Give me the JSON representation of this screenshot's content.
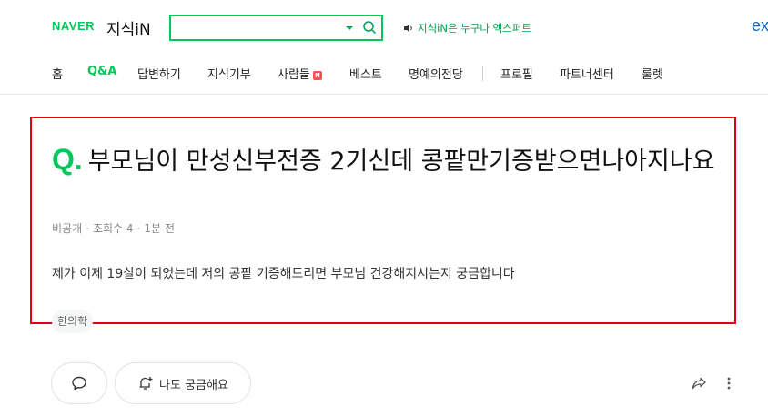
{
  "header": {
    "naver_logo": "NAVER",
    "kin_logo": "지식iN",
    "search_placeholder": "",
    "promo_text": "지식iN은 누구나 엑스퍼트",
    "ex_link": "ex",
    "accent": "#03c75a"
  },
  "nav": {
    "items": [
      {
        "label": "홈"
      },
      {
        "label": "Q&A"
      },
      {
        "label": "답변하기"
      },
      {
        "label": "지식기부"
      },
      {
        "label": "사람들"
      },
      {
        "label": "베스트"
      },
      {
        "label": "명예의전당"
      },
      {
        "label": "프로필"
      },
      {
        "label": "파트너센터"
      },
      {
        "label": "룰렛"
      }
    ],
    "badge": "N"
  },
  "question": {
    "q_mark": "Q.",
    "title": "부모님이 만성신부전증 2기신데 콩팥만기증받으면나아지나요",
    "author": "비공개",
    "views": "조회수 4",
    "time": "1분 전",
    "body": "제가 이제 19살이 되었는데 저의 콩팥 기증해드리면 부모님 건강해지시는지 궁금합니다",
    "tag": "한의학",
    "highlight_color": "#e1000f"
  },
  "actions": {
    "curious_label": "나도 궁금해요"
  }
}
